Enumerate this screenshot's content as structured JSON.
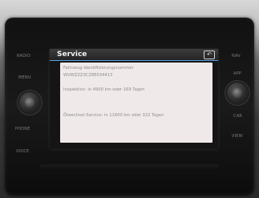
{
  "left_controls": {
    "radio_label": "RADIO",
    "menu_label": "MENU",
    "phone_label": "PHONE",
    "voice_label": "VOICE"
  },
  "right_controls": {
    "top_label": "NAV",
    "second_label": "APP",
    "car_label": "CAR",
    "view_label": "VIEW"
  },
  "screen": {
    "title": "Service",
    "back_icon": "back-arrow-icon",
    "lines": [
      "Fahrzeug-Identifizierungsnummer",
      "WVWZZZ3CZ8E034413",
      "Inspektion: in 4900 km oder 169 Tagen",
      "Ölwechsel-Service: in 11600 km oder 322 Tagen"
    ]
  }
}
